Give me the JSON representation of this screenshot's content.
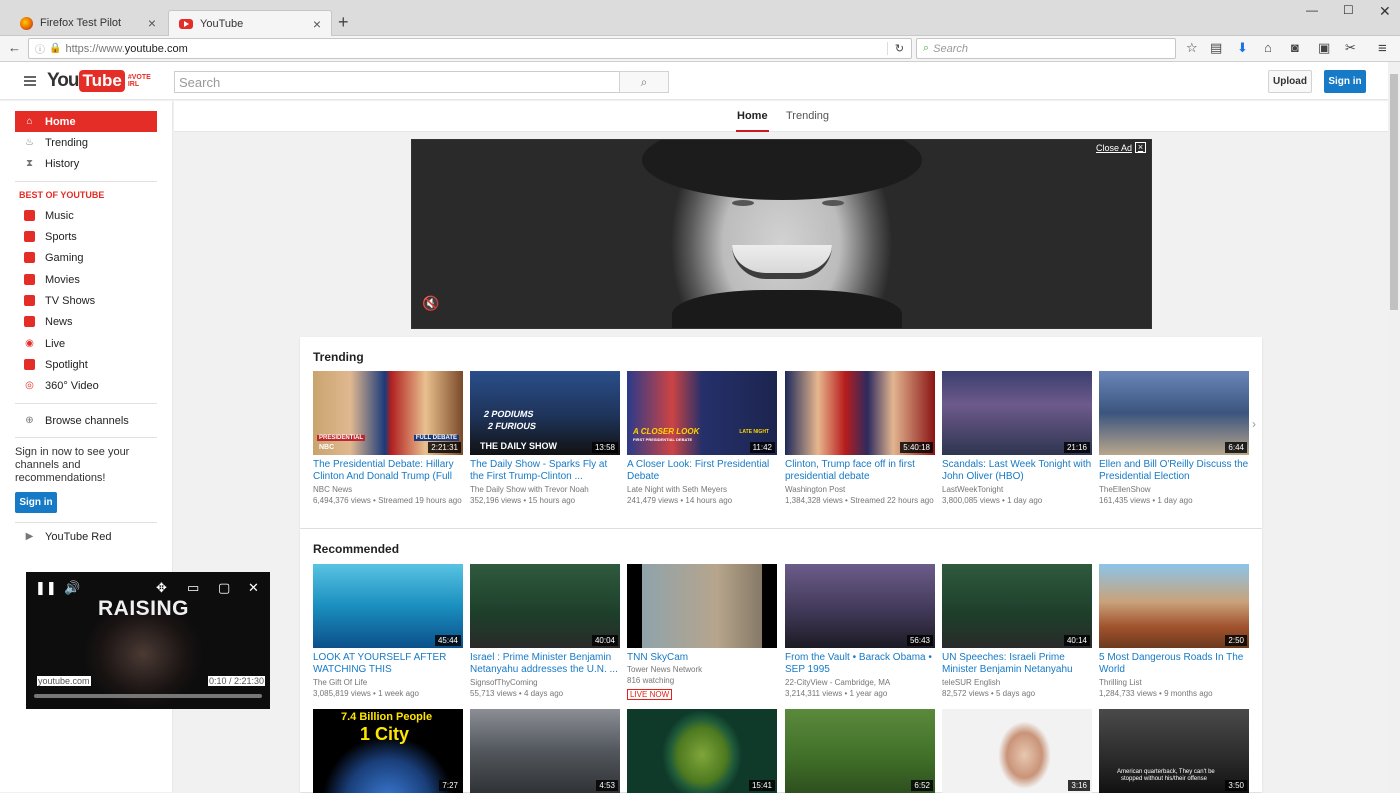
{
  "browser": {
    "tabs": [
      {
        "label": "Firefox Test Pilot",
        "active": false
      },
      {
        "label": "YouTube",
        "active": true
      }
    ],
    "url_prefix": "https://www.",
    "url_domain": "youtube.com",
    "search_placeholder": "Search"
  },
  "header": {
    "logo_you": "You",
    "logo_tube": "Tube",
    "logo_badge_1": "#VOTE",
    "logo_badge_2": "IRL",
    "search_placeholder": "Search",
    "upload_label": "Upload",
    "signin_label": "Sign in"
  },
  "sidebar": {
    "main": [
      {
        "label": "Home",
        "icon": "home-icon"
      },
      {
        "label": "Trending",
        "icon": "flame-icon"
      },
      {
        "label": "History",
        "icon": "hourglass-icon"
      }
    ],
    "best_heading": "BEST OF YOUTUBE",
    "best": [
      {
        "label": "Music"
      },
      {
        "label": "Sports"
      },
      {
        "label": "Gaming"
      },
      {
        "label": "Movies"
      },
      {
        "label": "TV Shows"
      },
      {
        "label": "News"
      },
      {
        "label": "Live"
      },
      {
        "label": "Spotlight"
      },
      {
        "label": "360° Video"
      }
    ],
    "browse_channels": "Browse channels",
    "signin_prompt": "Sign in now to see your channels and recommendations!",
    "signin_label": "Sign in",
    "youtube_red": "YouTube Red"
  },
  "feed_tabs": {
    "home": "Home",
    "trending": "Trending"
  },
  "ad": {
    "close_label": "Close Ad"
  },
  "trending": {
    "title": "Trending",
    "videos": [
      {
        "title": "The Presidential Debate: Hillary Clinton And Donald Trump (Full ...",
        "channel": "NBC News",
        "views": "6,494,376 views",
        "age": "Streamed 19 hours ago",
        "duration": "2:21:31"
      },
      {
        "title": "The Daily Show - Sparks Fly at the First Trump-Clinton ...",
        "channel": "The Daily Show with Trevor Noah",
        "views": "352,196 views",
        "age": "15 hours ago",
        "duration": "13:58"
      },
      {
        "title": "A Closer Look: First Presidential Debate",
        "channel": "Late Night with Seth Meyers",
        "views": "241,479 views",
        "age": "14 hours ago",
        "duration": "11:42"
      },
      {
        "title": "Clinton, Trump face off in first presidential debate",
        "channel": "Washington Post",
        "views": "1,384,328 views",
        "age": "Streamed 22 hours ago",
        "duration": "5:40:18"
      },
      {
        "title": "Scandals: Last Week Tonight with John Oliver (HBO)",
        "channel": "LastWeekTonight",
        "views": "3,800,085 views",
        "age": "1 day ago",
        "duration": "21:16"
      },
      {
        "title": "Ellen and Bill O'Reilly Discuss the Presidential Election",
        "channel": "TheEllenShow",
        "views": "161,435 views",
        "age": "1 day ago",
        "duration": "6:44"
      }
    ]
  },
  "recommended": {
    "title": "Recommended",
    "videos": [
      {
        "title": "LOOK AT YOURSELF AFTER WATCHING THIS",
        "channel": "The Gift Of Life",
        "views": "3,085,819 views",
        "age": "1 week ago",
        "duration": "45:44"
      },
      {
        "title": "Israel : Prime Minister Benjamin Netanyahu addresses the U.N. ...",
        "channel": "SignsofThyComing",
        "views": "55,713 views",
        "age": "4 days ago",
        "duration": "40:04"
      },
      {
        "title": "TNN SkyCam",
        "channel": "Tower News Network",
        "views": "816 watching",
        "age": "",
        "live": "LIVE NOW",
        "duration": ""
      },
      {
        "title": "From the Vault • Barack Obama • SEP 1995",
        "channel": "22-CityView - Cambridge, MA",
        "views": "3,214,311 views",
        "age": "1 year ago",
        "duration": "56:43"
      },
      {
        "title": "UN Speeches: Israeli Prime Minister Benjamin Netanyahu",
        "channel": "teleSUR English",
        "views": "82,572 views",
        "age": "5 days ago",
        "duration": "40:14"
      },
      {
        "title": "5 Most Dangerous Roads In The World",
        "channel": "Thrilling List",
        "views": "1,284,733 views",
        "age": "9 months ago",
        "duration": "2:50"
      }
    ],
    "row2": [
      {
        "duration": "7:27",
        "overlay1": "7.4 Billion People",
        "overlay2": "1 City"
      },
      {
        "duration": "4:53"
      },
      {
        "duration": "15:41"
      },
      {
        "duration": "6:52"
      },
      {
        "duration": "3:16"
      },
      {
        "duration": "3:50",
        "overlay1": "American quarterback, They can't be",
        "overlay2": "stopped without his/their offense"
      }
    ]
  },
  "thumb_text": {
    "debate_full": "FULL DEBATE",
    "presidential": "PRESIDENTIAL",
    "nbc": "NBC",
    "podiums": "2 PODIUMS",
    "furious": "2 FURIOUS",
    "daily_show": "THE DAILY SHOW",
    "closer_look": "A CLOSER LOOK",
    "first_debate": "FIRST PRESIDENTIAL DEBATE",
    "late_night": "LATE NIGHT"
  },
  "miniplayer": {
    "overlay_text": "RAISING",
    "site": "youtube.com",
    "time": "0:10 / 2:21:30"
  }
}
